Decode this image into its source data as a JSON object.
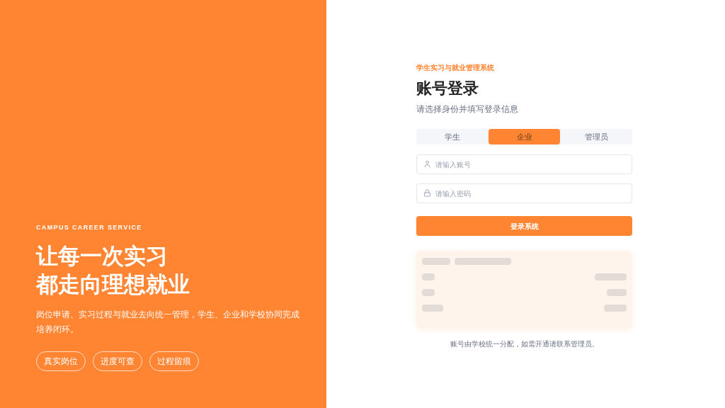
{
  "hero": {
    "eyebrow": "CAMPUS CAREER SERVICE",
    "headline": [
      "让每一次实习",
      "都走向理想就业"
    ],
    "description": "岗位申请、实习过程与就业去向统一管理，学生、企业和学校协同完成培养闭环。",
    "tags": [
      "真实岗位",
      "进度可查",
      "过程留痕"
    ]
  },
  "login": {
    "system_name": "学生实习与就业管理系统",
    "title": "账号登录",
    "subtitle": "请选择身份并填写登录信息",
    "roles": [
      {
        "label": "学生",
        "selected": false
      },
      {
        "label": "企业",
        "selected": true
      },
      {
        "label": "管理员",
        "selected": false
      }
    ],
    "fields": [
      {
        "kind": "user",
        "placeholder": "请输入账号"
      },
      {
        "kind": "password",
        "placeholder": "请输入密码"
      }
    ],
    "submit": "登录系统",
    "notice_card": {
      "kind": "redacted"
    },
    "footnote": "账号由学校统一分配，如需开通请联系管理员。"
  }
}
